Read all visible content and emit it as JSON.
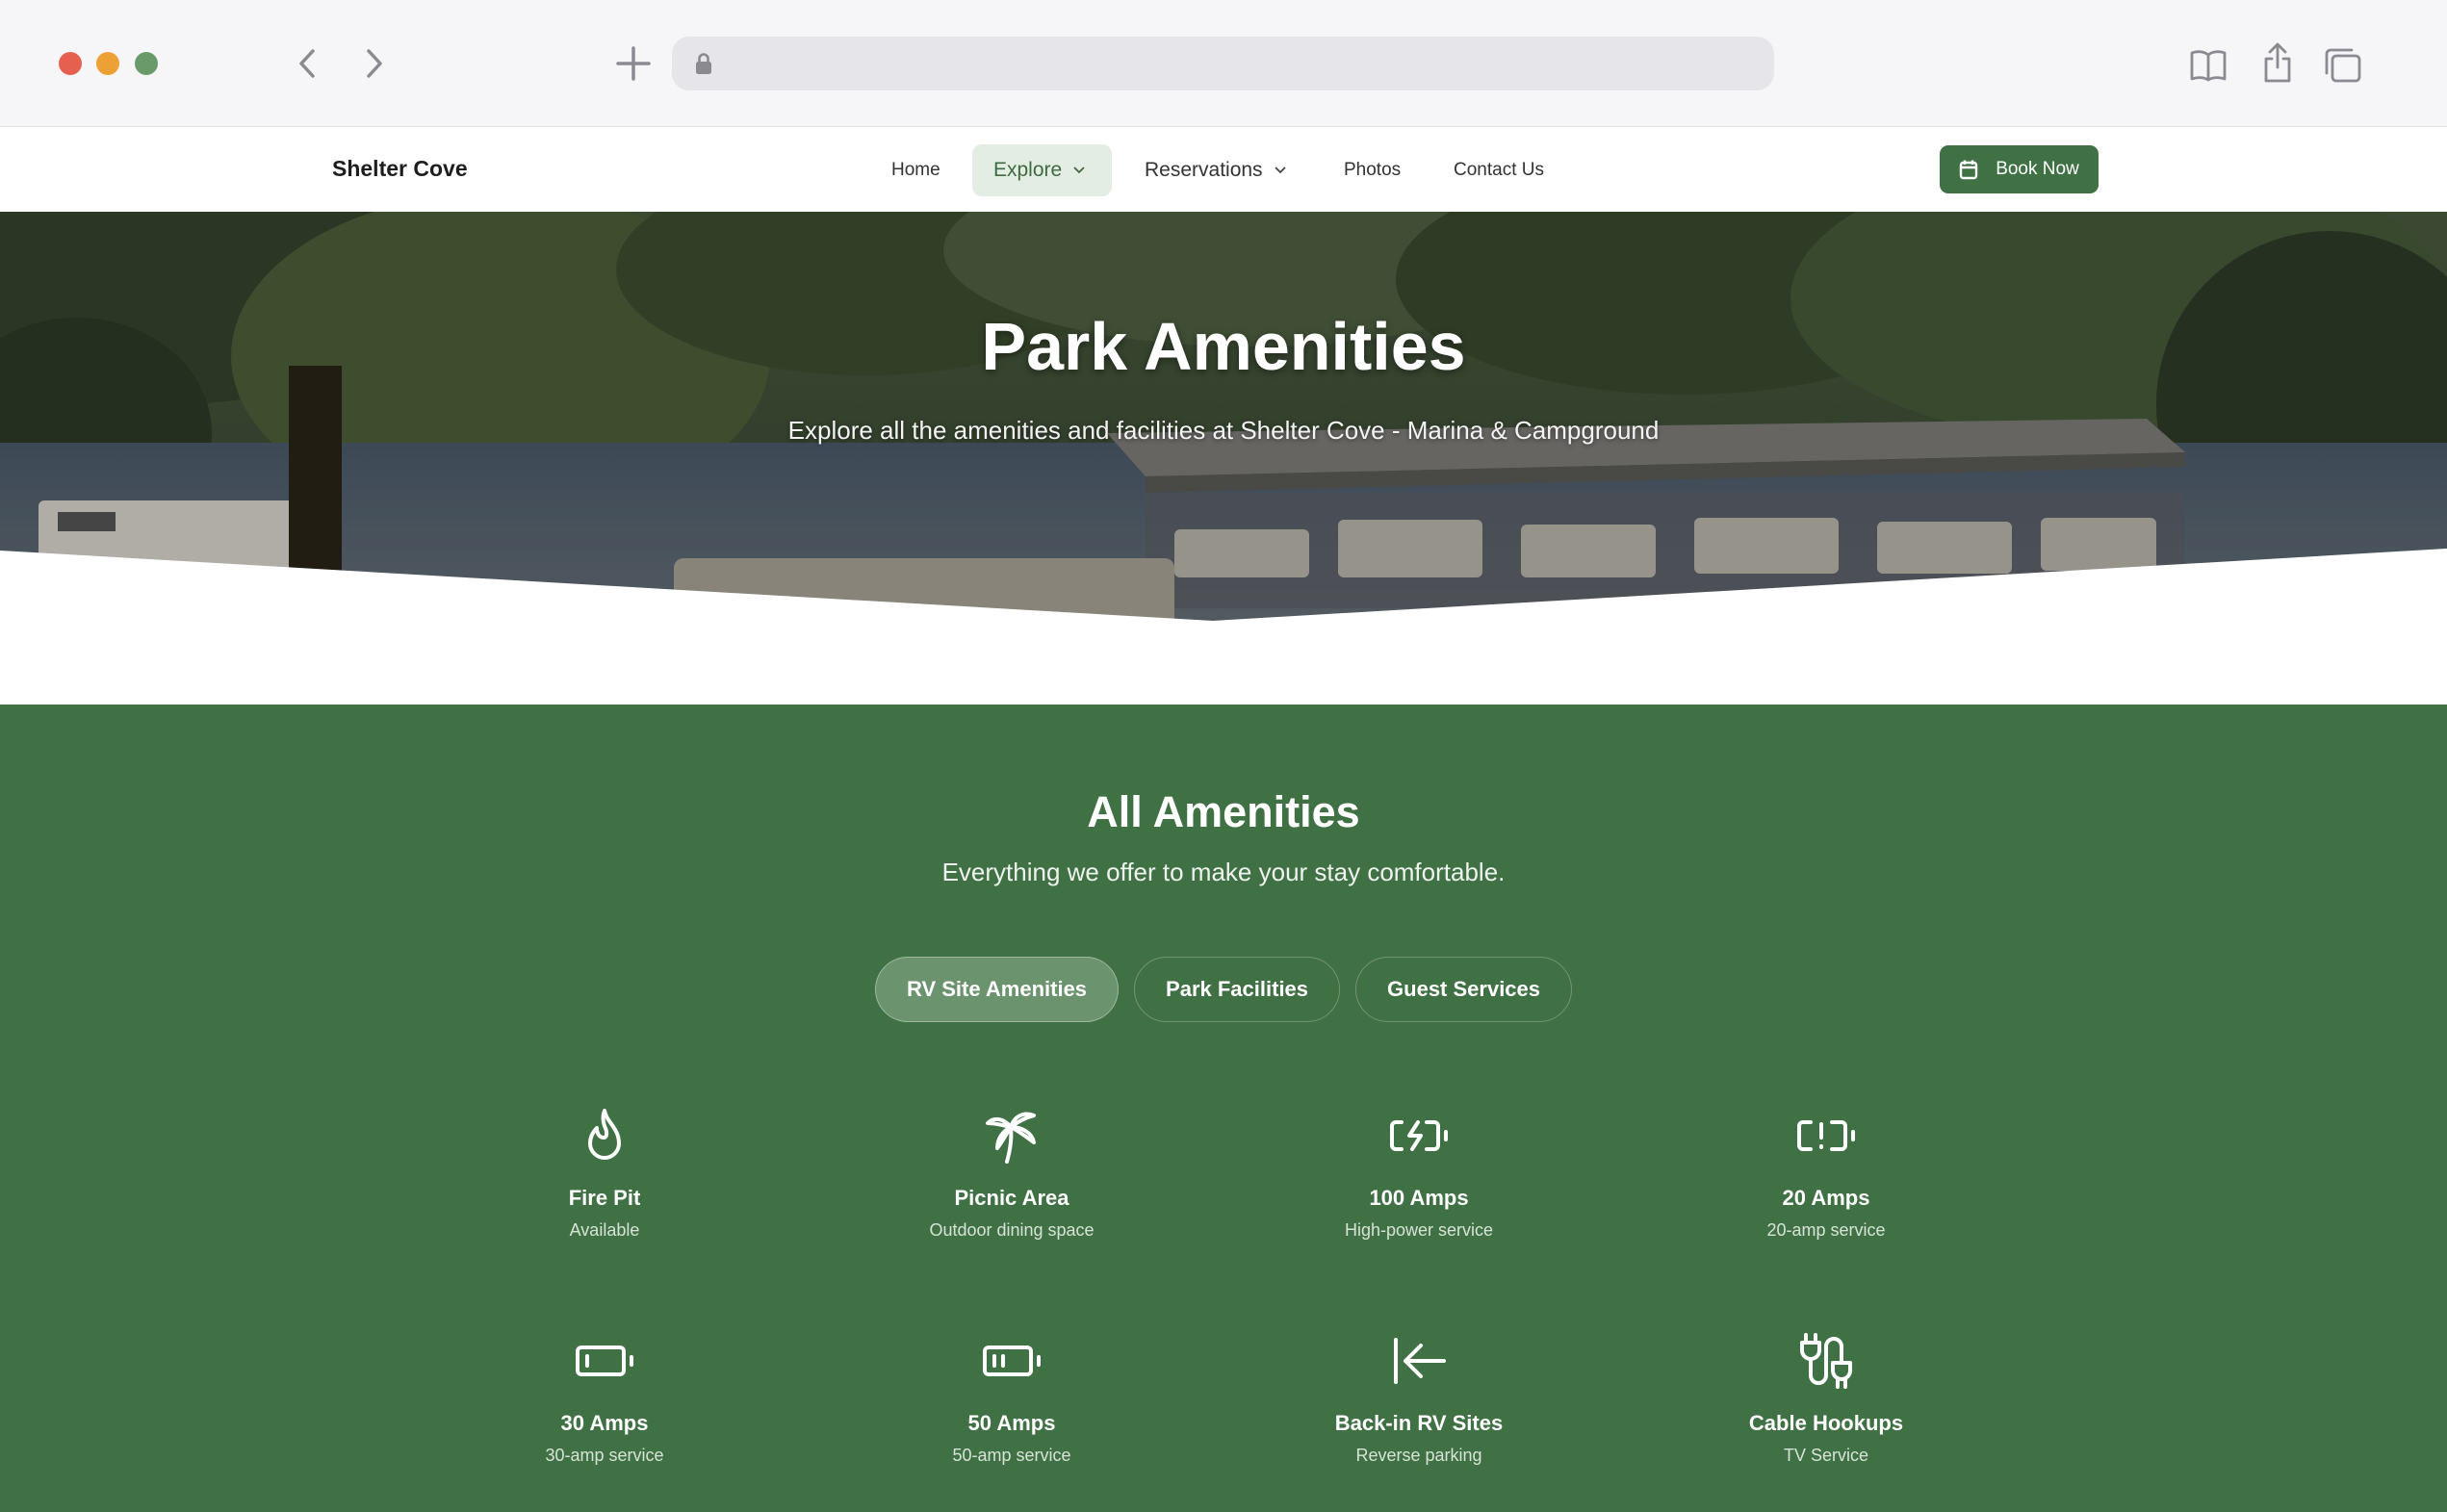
{
  "browser": {
    "address_value": ""
  },
  "nav": {
    "brand": "Shelter Cove",
    "items": [
      {
        "label": "Home"
      },
      {
        "label": "Explore"
      },
      {
        "label": "Reservations"
      },
      {
        "label": "Photos"
      },
      {
        "label": "Contact Us"
      }
    ],
    "cta": "Book Now"
  },
  "hero": {
    "title": "Park Amenities",
    "subtitle": "Explore all the amenities and facilities at Shelter Cove - Marina & Campground"
  },
  "amenities": {
    "title": "All Amenities",
    "subtitle": "Everything we offer to make your stay comfortable.",
    "tabs": [
      {
        "label": "RV Site Amenities",
        "selected": true
      },
      {
        "label": "Park Facilities",
        "selected": false
      },
      {
        "label": "Guest Services",
        "selected": false
      }
    ],
    "items": [
      {
        "icon": "flame-icon",
        "name": "Fire Pit",
        "desc": "Available"
      },
      {
        "icon": "palm-tree-icon",
        "name": "Picnic Area",
        "desc": "Outdoor dining space"
      },
      {
        "icon": "battery-charging-icon",
        "name": "100 Amps",
        "desc": "High-power service"
      },
      {
        "icon": "battery-warning-icon",
        "name": "20 Amps",
        "desc": "20-amp service"
      },
      {
        "icon": "battery-low-icon",
        "name": "30 Amps",
        "desc": "30-amp service"
      },
      {
        "icon": "battery-medium-icon",
        "name": "50 Amps",
        "desc": "50-amp service"
      },
      {
        "icon": "arrow-left-to-line-icon",
        "name": "Back-in RV Sites",
        "desc": "Reverse parking"
      },
      {
        "icon": "cable-icon",
        "name": "Cable Hookups",
        "desc": "TV Service"
      }
    ]
  },
  "colors": {
    "brand_green": "#407145",
    "tab_selected": "#6b946e",
    "nav_active_bg": "#e3ede3"
  }
}
